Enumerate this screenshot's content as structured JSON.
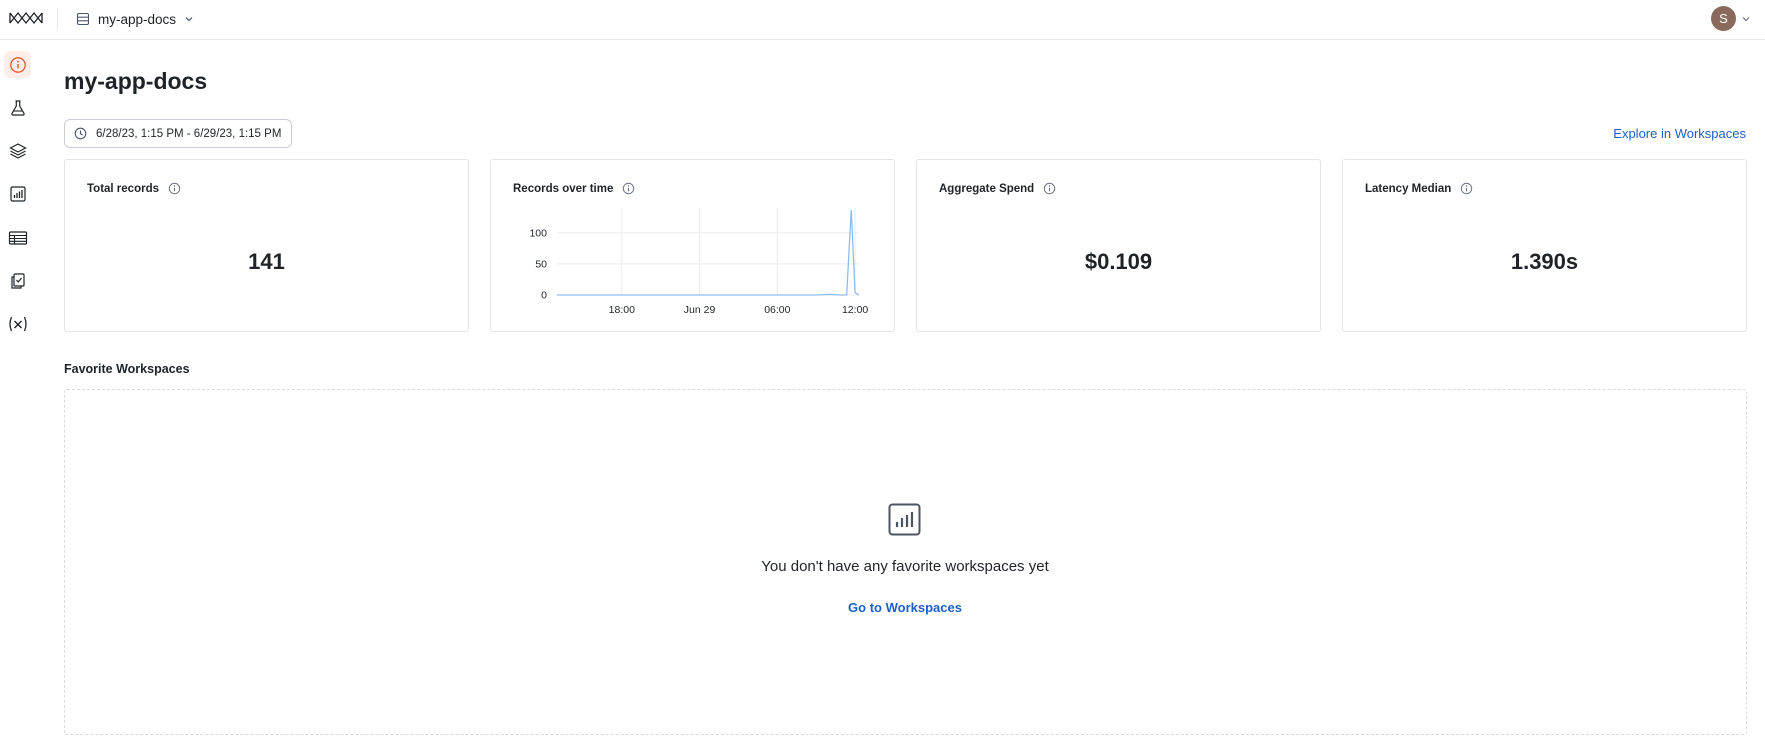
{
  "topbar": {
    "project_name": "my-app-docs",
    "user_initial": "S"
  },
  "sidebar": {
    "items": [
      {
        "name": "overview",
        "icon": "info-icon",
        "active": true
      },
      {
        "name": "experiments",
        "icon": "flask-icon",
        "active": false
      },
      {
        "name": "layers",
        "icon": "layers-icon",
        "active": false
      },
      {
        "name": "analytics",
        "icon": "bar-chart-icon",
        "active": false
      },
      {
        "name": "datasets",
        "icon": "table-icon",
        "active": false
      },
      {
        "name": "evaluations",
        "icon": "clipboard-icon",
        "active": false
      },
      {
        "name": "variables",
        "icon": "variable-icon",
        "active": false
      }
    ]
  },
  "page": {
    "title": "my-app-docs",
    "date_range": "6/28/23, 1:15 PM - 6/29/23, 1:15 PM",
    "explore_link": "Explore in Workspaces"
  },
  "cards": {
    "total_records": {
      "title": "Total records",
      "value": "141"
    },
    "records_over_time": {
      "title": "Records over time"
    },
    "aggregate_spend": {
      "title": "Aggregate Spend",
      "value": "$0.109"
    },
    "latency_median": {
      "title": "Latency Median",
      "value": "1.390s"
    }
  },
  "favorites": {
    "title": "Favorite Workspaces",
    "empty_text": "You don't have any favorite workspaces yet",
    "cta": "Go to Workspaces"
  },
  "colors": {
    "accent": "#e8572a",
    "link": "#1d5fc8",
    "line": "#8fbcf0"
  },
  "chart_data": {
    "type": "line",
    "title": "Records over time",
    "x_ticks": [
      "18:00",
      "Jun 29",
      "06:00",
      "12:00"
    ],
    "y_ticks": [
      0,
      50,
      100
    ],
    "ylim": [
      0,
      140
    ],
    "grid": true,
    "series": [
      {
        "x": [
          0,
          0.5,
          1,
          2,
          4,
          6,
          8,
          10,
          12,
          14,
          16,
          18,
          20,
          21,
          21.9,
          22.35,
          22.7,
          23,
          23.3
        ],
        "values": [
          0,
          0,
          0,
          0,
          0,
          0,
          0,
          0,
          0,
          0,
          0,
          0,
          0,
          1,
          0,
          0,
          137,
          4,
          0
        ]
      }
    ]
  }
}
